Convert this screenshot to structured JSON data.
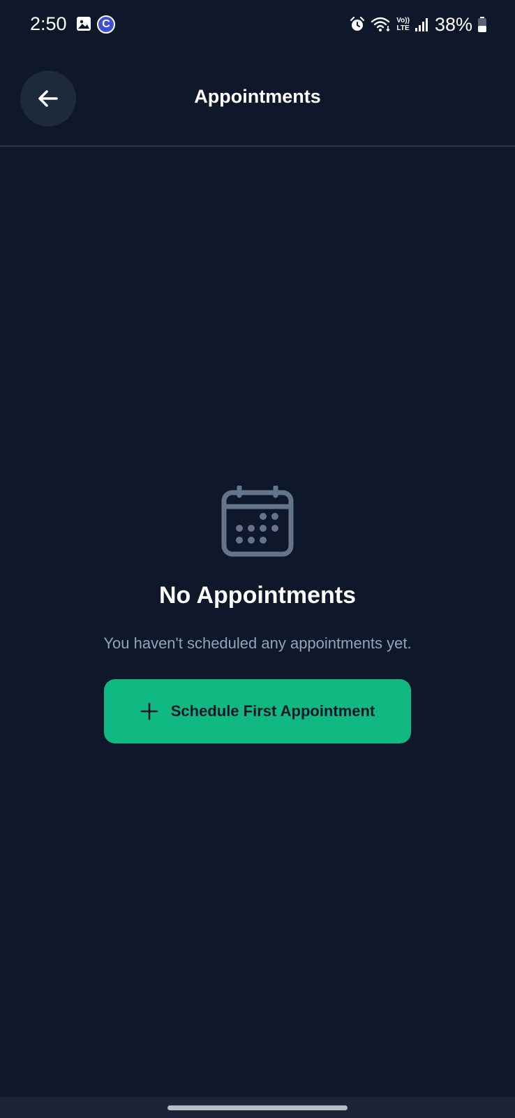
{
  "status_bar": {
    "time": "2:50",
    "battery_text": "38%",
    "volte_top": "Vo))",
    "volte_bottom": "LTE",
    "icons": [
      "gallery-icon",
      "c-app-icon",
      "alarm-icon",
      "wifi-icon",
      "volte-icon",
      "signal-icon",
      "battery-icon"
    ],
    "c_icon_letter": "C"
  },
  "header": {
    "title": "Appointments",
    "back_icon": "arrow-left-icon"
  },
  "empty_state": {
    "icon": "calendar-icon",
    "title": "No Appointments",
    "subtitle": "You haven't scheduled any appointments yet.",
    "button_label": "Schedule First Appointment",
    "button_icon": "plus-icon"
  },
  "colors": {
    "background": "#0f172a",
    "surface": "#1e293b",
    "accent": "#10b981",
    "muted_text": "#94a3b8",
    "icon_muted": "#64748b"
  }
}
